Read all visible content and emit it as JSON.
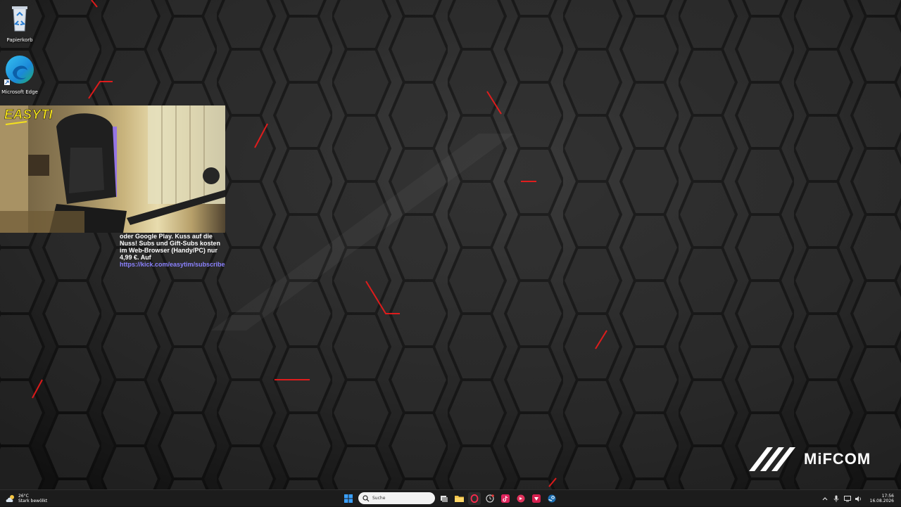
{
  "desktop": {
    "icons": [
      {
        "label": "Papierkorb",
        "icon": "recycle-bin-icon"
      },
      {
        "label": "Microsoft Edge",
        "icon": "edge-icon"
      }
    ]
  },
  "overlay": {
    "logo_text": "EASYTIM",
    "chat_text": "oder Google Play. Kuss auf die Nuss! Subs und Gift-Subs kosten im Web-Browser (Handy/PC) nur 4,99 €. Auf",
    "chat_link": "https://kick.com/easytim/subscribe"
  },
  "wallpaper": {
    "brand": "MiFCOM",
    "colors": {
      "base": "#151515",
      "hex_edge": "#000000",
      "glow": "#ff1a1a"
    }
  },
  "taskbar": {
    "weather": {
      "temp": "26°C",
      "desc": "Stark bewölkt"
    },
    "search_placeholder": "Suche",
    "apps": [
      "start-icon",
      "task-view-icon",
      "file-explorer-icon",
      "opera-gx-icon",
      "clock-icon",
      "tiktok-icon",
      "music-app-icon",
      "tidal-icon",
      "steam-icon"
    ],
    "clock": {
      "time": "17:56",
      "date": "16.08.2026"
    }
  }
}
